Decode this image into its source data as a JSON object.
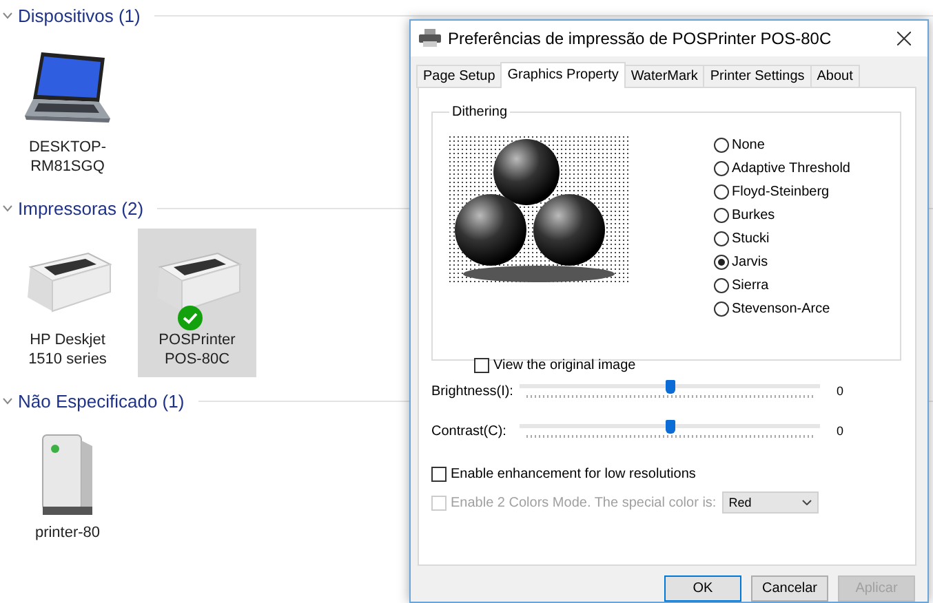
{
  "explorer": {
    "groups": [
      {
        "title": "Dispositivos (1)",
        "items": [
          {
            "kind": "laptop",
            "label": "DESKTOP-RM81SGQ",
            "selected": false,
            "default": false
          }
        ]
      },
      {
        "title": "Impressoras (2)",
        "items": [
          {
            "kind": "printer",
            "label": "HP Deskjet 1510 series",
            "selected": false,
            "default": false
          },
          {
            "kind": "printer",
            "label": "POSPrinter POS-80C",
            "selected": true,
            "default": true
          }
        ]
      },
      {
        "title": "Não Especificado (1)",
        "items": [
          {
            "kind": "tower",
            "label": "printer-80",
            "selected": false,
            "default": false
          }
        ]
      }
    ]
  },
  "dialog": {
    "title": "Preferências de impressão de POSPrinter POS-80C",
    "tabs": [
      {
        "label": "Page Setup",
        "selected": false
      },
      {
        "label": "Graphics Property",
        "selected": true
      },
      {
        "label": "WaterMark",
        "selected": false
      },
      {
        "label": "Printer Settings",
        "selected": false
      },
      {
        "label": "About",
        "selected": false
      }
    ],
    "dithering": {
      "title": "Dithering",
      "options": [
        {
          "label": "None",
          "selected": false
        },
        {
          "label": "Adaptive Threshold",
          "selected": false
        },
        {
          "label": "Floyd-Steinberg",
          "selected": false
        },
        {
          "label": "Burkes",
          "selected": false
        },
        {
          "label": "Stucki",
          "selected": false
        },
        {
          "label": "Jarvis",
          "selected": true
        },
        {
          "label": "Sierra",
          "selected": false
        },
        {
          "label": "Stevenson-Arce",
          "selected": false
        }
      ],
      "view_original": {
        "label": "View the original image",
        "checked": false
      }
    },
    "sliders": [
      {
        "label": "Brightness(I):",
        "level": 0.5,
        "reading": "0"
      },
      {
        "label": "Contrast(C):",
        "level": 0.5,
        "reading": "0"
      }
    ],
    "enhancement": {
      "label": "Enable enhancement for low resolutions",
      "checked": false,
      "disabled": false
    },
    "two_colors": {
      "label": "Enable 2 Colors Mode. The special color is:",
      "checked": false,
      "disabled": true,
      "color_value": "Red"
    },
    "buttons": [
      {
        "label": "OK",
        "kind": "default",
        "disabled": false
      },
      {
        "label": "Cancelar",
        "kind": "normal",
        "disabled": false
      },
      {
        "label": "Aplicar",
        "kind": "normal",
        "disabled": true
      }
    ]
  }
}
